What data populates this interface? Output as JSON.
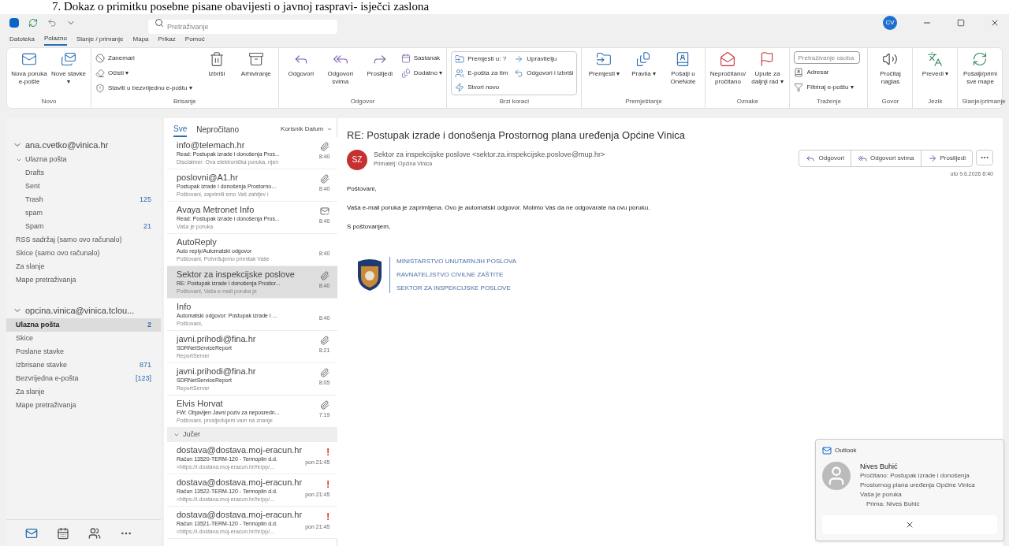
{
  "caption": "7. Dokaz o primitku posebne pisane obavijesti o javnoj raspravi- isječci zaslona",
  "title_bar": {
    "search_placeholder": "Pretraživanje",
    "avatar": "CV"
  },
  "menu_tabs": [
    {
      "label": "Datoteka",
      "selected": false
    },
    {
      "label": "Polazno",
      "selected": true
    },
    {
      "label": "Slanje / primanje",
      "selected": false
    },
    {
      "label": "Mapa",
      "selected": false
    },
    {
      "label": "Prikaz",
      "selected": false
    },
    {
      "label": "Pomoć",
      "selected": false
    }
  ],
  "ribbon": [
    {
      "label": "Novo",
      "items": [
        {
          "kind": "large",
          "label": "Nova poruka e-pošte"
        },
        {
          "kind": "large",
          "label": "Nove stavke ▾"
        }
      ]
    },
    {
      "label": "Brisanje",
      "items": [
        {
          "kind": "small",
          "label": "Zanemari"
        },
        {
          "kind": "small",
          "label": "Očisti ▾"
        },
        {
          "kind": "small",
          "label": "Staviti u bezvrijednu e-poštu ▾"
        },
        {
          "kind": "large",
          "label": "Izbriši"
        },
        {
          "kind": "large",
          "label": "Arhiviranje"
        }
      ]
    },
    {
      "label": "Odgovor",
      "items": [
        {
          "kind": "large",
          "label": "Odgovori"
        },
        {
          "kind": "large",
          "label": "Odgovori svima"
        },
        {
          "kind": "large",
          "label": "Proslijedi"
        },
        {
          "kind": "small",
          "label": "Sastanak"
        },
        {
          "kind": "small",
          "label": "Dodatno ▾"
        }
      ]
    },
    {
      "label": "Brzi koraci",
      "items": [
        {
          "kind": "small",
          "label": "Premjesti u: ?"
        },
        {
          "kind": "small",
          "label": "E-pošta za tim"
        },
        {
          "kind": "small",
          "label": "Stvori novo"
        },
        {
          "kind": "small",
          "label": "Upravitelju"
        },
        {
          "kind": "small",
          "label": "Odgovori i izbriši"
        }
      ]
    },
    {
      "label": "Premještanje",
      "items": [
        {
          "kind": "large",
          "label": "Premjesti ▾"
        },
        {
          "kind": "large",
          "label": "Pravila ▾"
        },
        {
          "kind": "large",
          "label": "Pošalji u OneNote"
        }
      ]
    },
    {
      "label": "Oznake",
      "items": [
        {
          "kind": "large",
          "label": "Nepročitano/ pročitano"
        },
        {
          "kind": "large",
          "label": "Upute za daljnji rad ▾"
        }
      ]
    },
    {
      "label": "Traženje",
      "items": [
        {
          "kind": "field",
          "placeholder": "Pretraživanje osoba"
        },
        {
          "kind": "small",
          "label": "Adresar"
        },
        {
          "kind": "small",
          "label": "Filtriraj e-poštu ▾"
        }
      ]
    },
    {
      "label": "Govor",
      "items": [
        {
          "kind": "large",
          "label": "Pročitaj naglas"
        }
      ]
    },
    {
      "label": "Jezik",
      "items": [
        {
          "kind": "large",
          "label": "Prevedi ▾"
        }
      ]
    },
    {
      "label": "Slanje/primanje",
      "items": [
        {
          "kind": "large",
          "label": "Pošalji/primi sve mape"
        }
      ]
    }
  ],
  "accounts": [
    {
      "name": "ana.cvetko@vinica.hr",
      "folders": [
        {
          "label": "Ulazna pošta",
          "expanded": true,
          "selected": false,
          "children": [
            {
              "label": "Drafts",
              "selected": false
            },
            {
              "label": "Sent",
              "selected": false
            },
            {
              "label": "Trash",
              "count": "125",
              "selected": false
            },
            {
              "label": "spam",
              "selected": false
            },
            {
              "label": "Spam",
              "count": "21",
              "selected": false
            }
          ]
        },
        {
          "label": "RSS sadržaj (samo ovo računalo)",
          "selected": false
        },
        {
          "label": "Skice (samo ovo računalo)",
          "selected": false
        },
        {
          "label": "Za slanje",
          "selected": false
        },
        {
          "label": "Mape pretraživanja",
          "selected": false
        }
      ]
    },
    {
      "name": "opcina.vinica@vinica.tclou...",
      "folders": [
        {
          "label": "Ulazna pošta",
          "count": "2",
          "selected": true
        },
        {
          "label": "Skice",
          "selected": false
        },
        {
          "label": "Poslane stavke",
          "selected": false
        },
        {
          "label": "Izbrisane stavke",
          "count": "871",
          "selected": false
        },
        {
          "label": "Bezvrijedna e-pošta",
          "count": "[123]",
          "selected": false
        },
        {
          "label": "Za slanje",
          "selected": false
        },
        {
          "label": "Mape pretraživanja",
          "selected": false
        }
      ]
    }
  ],
  "message_tabs": [
    {
      "label": "Sve",
      "selected": true
    },
    {
      "label": "Nepročitano",
      "selected": false
    }
  ],
  "sort": "Korisnik Datum",
  "messages": [
    {
      "kind": "message",
      "sender": "info@telemach.hr",
      "subject": "Read: Postupak izrade i donošenja Pros...",
      "preview": "Disclaimer: Ova elektronička poruka, njen",
      "time": "8:40",
      "attachment": true,
      "receipt": false,
      "selected": false
    },
    {
      "kind": "message",
      "sender": "poslovni@A1.hr",
      "subject": "Postupak izrade i donošenja Prostorno...",
      "preview": "Poštovani, zaprimili smo Vaš zahtjev i",
      "time": "8:40",
      "attachment": true,
      "receipt": false,
      "selected": false
    },
    {
      "kind": "message",
      "sender": "Avaya Metronet Info",
      "subject": "Read: Postupak izrade i donošenja Pros...",
      "preview": "Vaša je poruka",
      "time": "8:40",
      "attachment": false,
      "receipt": true,
      "selected": false
    },
    {
      "kind": "message",
      "sender": "AutoReply",
      "subject": "Auto reply/Automatski odgovor",
      "preview": "Poštovani, Potvrđujemo primitak Vaše",
      "time": "8:40",
      "attachment": false,
      "receipt": false,
      "selected": false
    },
    {
      "kind": "message",
      "sender": "Sektor za inspekcijske poslove",
      "subject": "RE: Postupak izrade i donošenja Prostor...",
      "preview": "Poštovani, Vaša e-mail poruka je",
      "time": "8:40",
      "attachment": true,
      "receipt": false,
      "selected": true
    },
    {
      "kind": "message",
      "sender": "Info",
      "subject": "Automatski odgovor: Postupak izrade i ...",
      "preview": "Poštovani,",
      "time": "8:40",
      "attachment": false,
      "receipt": false,
      "selected": false
    },
    {
      "kind": "message",
      "sender": "javni.prihodi@fina.hr",
      "subject": "SDRNetServiceReport",
      "preview": "ReportServer",
      "time": "8:21",
      "attachment": true,
      "receipt": false,
      "selected": false
    },
    {
      "kind": "message",
      "sender": "javni.prihodi@fina.hr",
      "subject": "SDRNetServiceReport",
      "preview": "ReportServer",
      "time": "8:05",
      "attachment": true,
      "receipt": false,
      "selected": false
    },
    {
      "kind": "message",
      "sender": "Elvis Horvat",
      "subject": "FW: Objavljen Javni poziv za neposredn...",
      "preview": "Poštovani, prosljeđujem vam na znanje",
      "time": "7:19",
      "attachment": true,
      "receipt": false,
      "selected": false
    },
    {
      "kind": "group",
      "label": "Jučer"
    },
    {
      "kind": "message",
      "sender": "dostava@dostava.moj-eracun.hr",
      "subject": "Račun 13520-TERM-120 - Termoplin d.d.",
      "preview": "<https://i.dostava.moj-eracun.hr/hr/pp/...",
      "time": "pon 21:45",
      "attachment": false,
      "receipt": false,
      "flag": "!",
      "selected": false
    },
    {
      "kind": "message",
      "sender": "dostava@dostava.moj-eracun.hr",
      "subject": "Račun 13522-TERM-120 - Termoplin d.d.",
      "preview": "<https://i.dostava.moj-eracun.hr/hr/pp/...",
      "time": "pon 21:45",
      "attachment": false,
      "receipt": false,
      "flag": "!",
      "selected": false
    },
    {
      "kind": "message",
      "sender": "dostava@dostava.moj-eracun.hr",
      "subject": "Račun 13521-TERM-120 - Termoplin d.d.",
      "preview": "<https://i.dostava.moj-eracun.hr/hr/pp/...",
      "time": "pon 21:45",
      "attachment": false,
      "receipt": false,
      "flag": "!",
      "selected": false
    }
  ],
  "reading": {
    "subject": "RE: Postupak izrade i donošenja Prostornog plana uređenja Općine Vinica",
    "avatar": "SZ",
    "from": "Sektor za inspekcijske poslove <sektor.za.inspekcijske.poslove@mup.hr>",
    "to": "Primatelj: Općina Vinica",
    "actions": [
      "Odgovori",
      "Odgovori svima",
      "Proslijedi"
    ],
    "date": "uto 9.6.2026 8:40",
    "body": [
      "Poštovani,",
      "Vaša e-mail poruka je zaprimljena. Ovo je automatski odgovor. Molimo Vas da ne odgovarate na ovu poruku.",
      "S poštovanjem,"
    ],
    "signature": [
      "MINISTARSTVO UNUTARNJIH POSLOVA",
      "RAVNATELJSTVO CIVILNE ZAŠTITE",
      "SEKTOR ZA INSPEKCIJSKE POSLOVE"
    ]
  },
  "notification": {
    "app": "Outlook",
    "sender": "Nives Buhić",
    "lines": [
      "Pročitano: Postupak izrade i donošenja",
      "Prostornog plana uređenja Općine Vinica",
      "Vaša je poruka"
    ],
    "recipient": "Prima: Nives Buhić"
  }
}
